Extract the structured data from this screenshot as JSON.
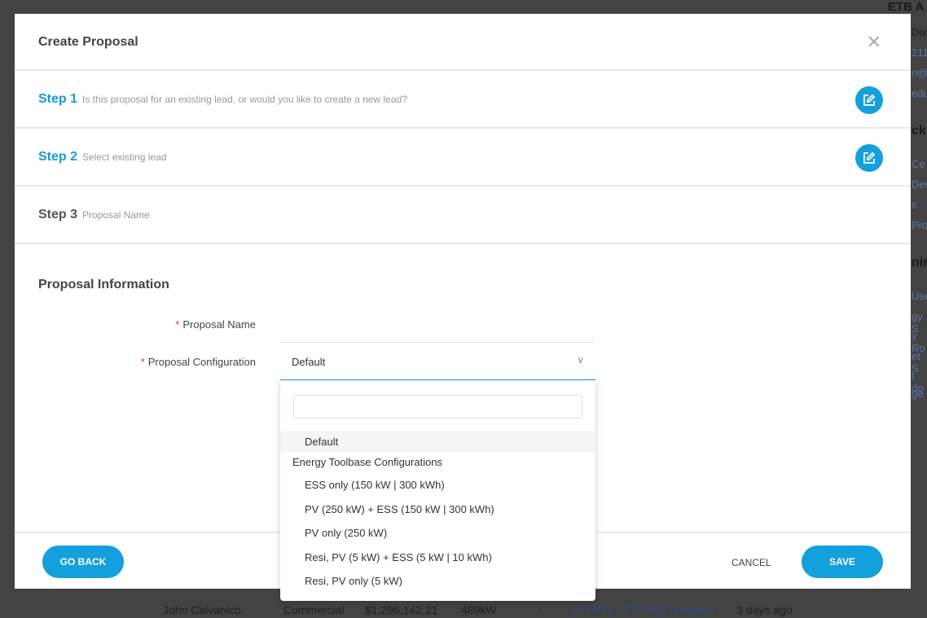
{
  "background": {
    "right_texts": [
      "ETB A",
      "Dix",
      "211",
      "n@",
      "edu",
      "ck",
      "Ce",
      "Dev",
      "s",
      "Proc",
      "nir",
      "Use",
      "gy S",
      "y Ro",
      "et S",
      "t do",
      "ge"
    ],
    "row": [
      "John Calvanico",
      "Commercial",
      "$1,296,142.21",
      "489kW",
      "-",
      "2018/19 - PV Only Template ...",
      "3 days ago"
    ]
  },
  "modal": {
    "title": "Create Proposal",
    "close": "✕",
    "steps": [
      {
        "num": "Step 1",
        "desc": "Is this proposal for an existing lead, or would you like to create a new lead?"
      },
      {
        "num": "Step 2",
        "desc": "Select existing lead"
      },
      {
        "num": "Step 3",
        "desc": "Proposal Name"
      }
    ],
    "section": "Proposal Information",
    "fields": {
      "name_label": "Proposal Name",
      "name_value": "",
      "config_label": "Proposal Configuration",
      "config_value": "Default"
    },
    "dropdown": {
      "search": "",
      "default": "Default",
      "group": "Energy Toolbase Configurations",
      "options": [
        "ESS only (150 kW | 300 kWh)",
        "PV (250 kW) + ESS (150 kW | 300 kWh)",
        "PV only (250 kW)",
        "Resi, PV (5 kW) + ESS (5 kW | 10 kWh)",
        "Resi, PV only (5 kW)"
      ]
    },
    "footer": {
      "back": "GO BACK",
      "cancel": "CANCEL",
      "save": "SAVE"
    }
  },
  "colors": {
    "accent": "#14a0dc"
  }
}
